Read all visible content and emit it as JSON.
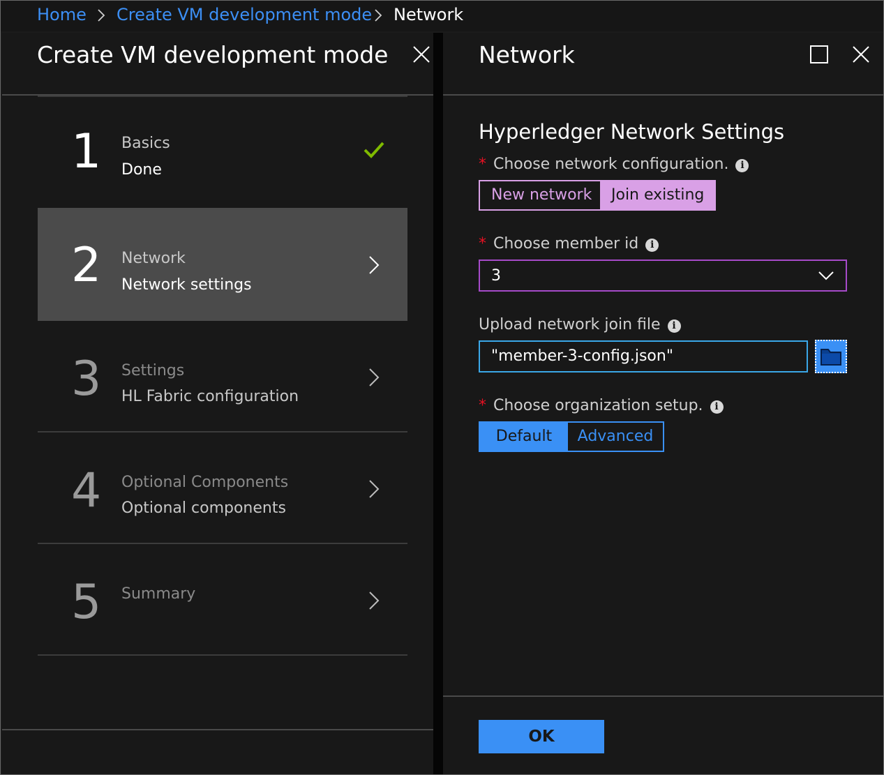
{
  "breadcrumb": {
    "items": [
      "Home",
      "Create VM development mode",
      "Network"
    ]
  },
  "left_blade": {
    "title": "Create VM development mode",
    "steps": [
      {
        "number": "1",
        "title": "Basics",
        "subtitle": "Done",
        "status": "done"
      },
      {
        "number": "2",
        "title": "Network",
        "subtitle": "Network settings",
        "status": "active"
      },
      {
        "number": "3",
        "title": "Settings",
        "subtitle": "HL Fabric configuration",
        "status": "pending"
      },
      {
        "number": "4",
        "title": "Optional Components",
        "subtitle": "Optional components",
        "status": "pending"
      },
      {
        "number": "5",
        "title": "Summary",
        "subtitle": "",
        "status": "pending"
      }
    ]
  },
  "right_blade": {
    "title": "Network",
    "section_title": "Hyperledger Network Settings",
    "network_config": {
      "label": "Choose network configuration.",
      "options": [
        "New network",
        "Join existing"
      ],
      "selected": "Join existing"
    },
    "member_id": {
      "label": "Choose member id",
      "value": "3"
    },
    "join_file": {
      "label": "Upload network join file",
      "value": "\"member-3-config.json\""
    },
    "org_setup": {
      "label": "Choose organization setup.",
      "options": [
        "Default",
        "Advanced"
      ],
      "selected": "Default"
    },
    "ok_label": "OK"
  },
  "icons": {
    "required_marker": "*",
    "info": "i",
    "done_check": "check-icon",
    "close": "close-icon",
    "maximize": "maximize-icon",
    "folder": "folder-icon",
    "chevron_right": "chevron-right-icon",
    "chevron_down": "chevron-down-icon"
  },
  "colors": {
    "background": "#181818",
    "link": "#3c8ff5",
    "accent_blue": "#3a90f5",
    "toggle_purple": "#d9a0e6",
    "select_border": "#a64ac9",
    "file_border": "#3aa7e8",
    "check_green": "#7fba00",
    "required_red": "#e81123"
  }
}
